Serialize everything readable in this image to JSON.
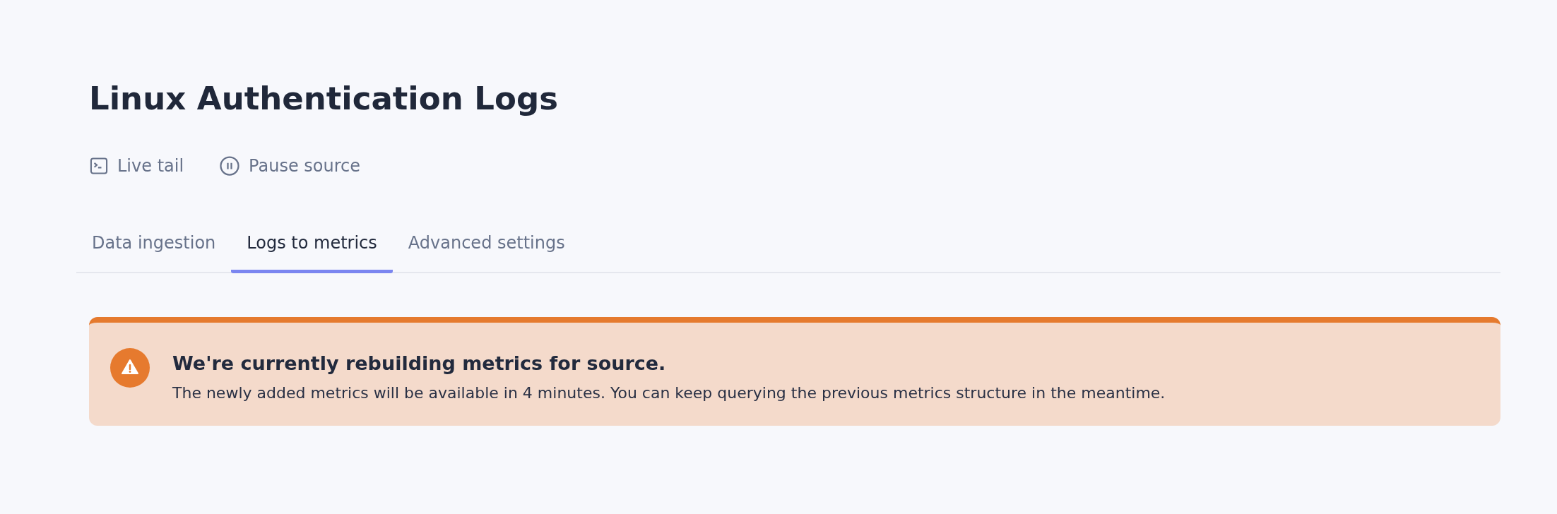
{
  "title": "Linux Authentication Logs",
  "actions": [
    {
      "kind": "terminal",
      "label": "Live tail"
    },
    {
      "kind": "pause",
      "label": "Pause source"
    }
  ],
  "tabs": [
    {
      "label": "Data ingestion",
      "selected": false
    },
    {
      "label": "Logs to metrics",
      "selected": true
    },
    {
      "label": "Advanced settings",
      "selected": false
    }
  ],
  "alert": {
    "kind": "warning",
    "heading": "We're currently rebuilding metrics for source.",
    "message": "The newly added metrics will be available in 4 minutes. You can keep querying the previous metrics structure in the meantime."
  }
}
